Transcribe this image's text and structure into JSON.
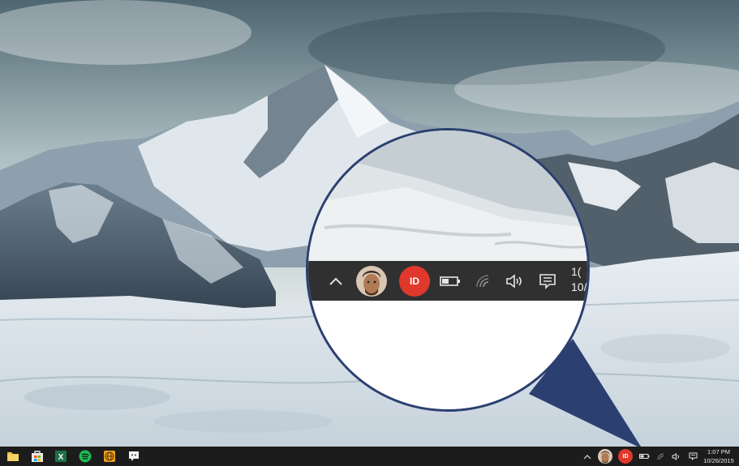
{
  "desktop": {
    "wallpaper": "snowy mountain range"
  },
  "magnifier": {
    "tray": {
      "chevron_icon": "chevron-up-icon",
      "avatar_icon": "user-avatar",
      "id_badge": "ID",
      "battery_icon": "battery-icon",
      "wifi_icon": "wifi-icon",
      "volume_icon": "volume-icon",
      "notification_icon": "action-center-icon",
      "clock_time": "1(",
      "clock_date": "10/"
    }
  },
  "taskbar": {
    "apps": [
      {
        "name": "File Explorer",
        "icon": "folder-icon"
      },
      {
        "name": "Store",
        "icon": "store-icon"
      },
      {
        "name": "Excel",
        "icon": "excel-icon"
      },
      {
        "name": "Spotify",
        "icon": "spotify-icon"
      },
      {
        "name": "Browser",
        "icon": "globe-icon"
      },
      {
        "name": "Chat",
        "icon": "chat-icon"
      }
    ],
    "tray": {
      "id_badge": "ID",
      "clock_time": "1:07 PM",
      "clock_date": "10/26/2015"
    }
  },
  "colors": {
    "taskbar": "#1c1c1c",
    "magnifier_border": "#2b3f70",
    "id_badge": "#e0382c"
  }
}
